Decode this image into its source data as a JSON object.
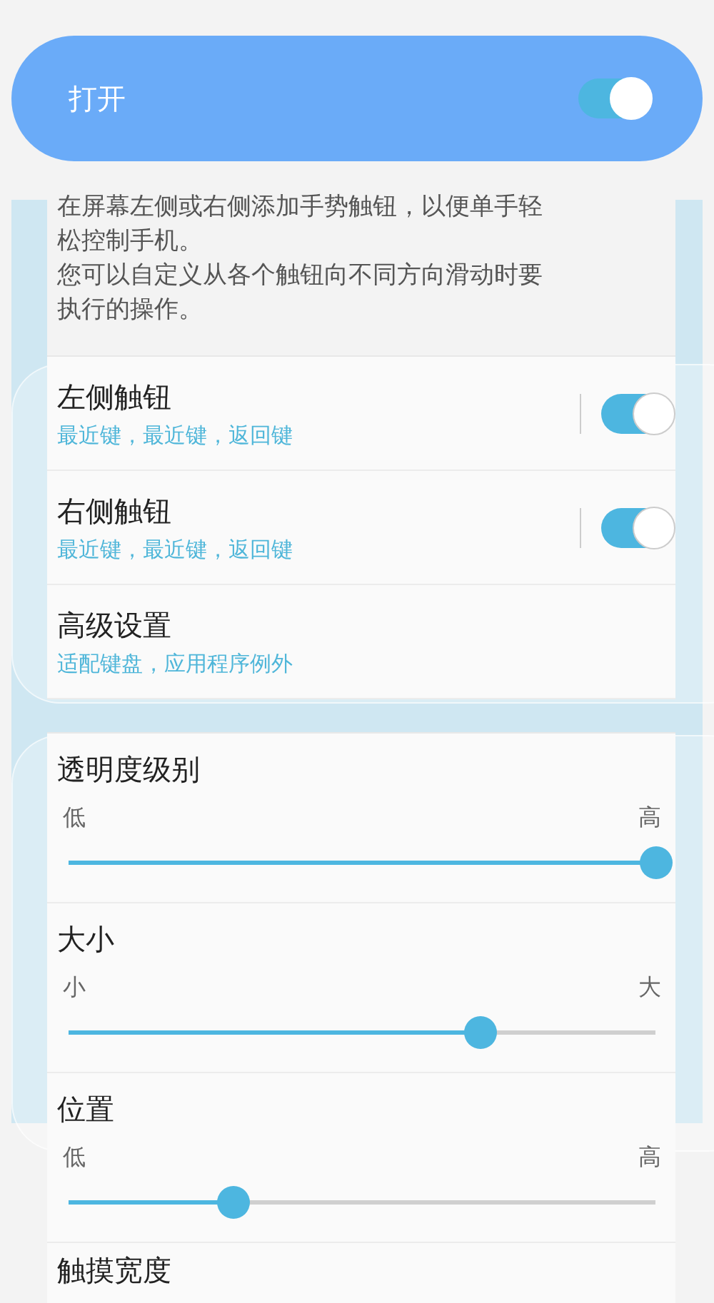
{
  "master": {
    "label": "打开",
    "on": true
  },
  "description": [
    "在屏幕左侧或右侧添加手势触钮，以便单手轻松控制手机。",
    "您可以自定义从各个触钮向不同方向滑动时要执行的操作。"
  ],
  "items": [
    {
      "kind": "toggle",
      "title": "左侧触钮",
      "subtitle": "最近键，最近键，返回键",
      "on": true
    },
    {
      "kind": "toggle",
      "title": "右侧触钮",
      "subtitle": "最近键，最近键，返回键",
      "on": true
    },
    {
      "kind": "link",
      "title": "高级设置",
      "subtitle": "适配键盘，应用程序例外"
    }
  ],
  "sliders": [
    {
      "title": "透明度级别",
      "min_label": "低",
      "max_label": "高",
      "level": 1.0
    },
    {
      "title": "大小",
      "min_label": "小",
      "max_label": "大",
      "level": 0.7
    },
    {
      "title": "位置",
      "min_label": "低",
      "max_label": "高",
      "level": 0.28
    }
  ],
  "next_section": {
    "title": "触摸宽度"
  }
}
